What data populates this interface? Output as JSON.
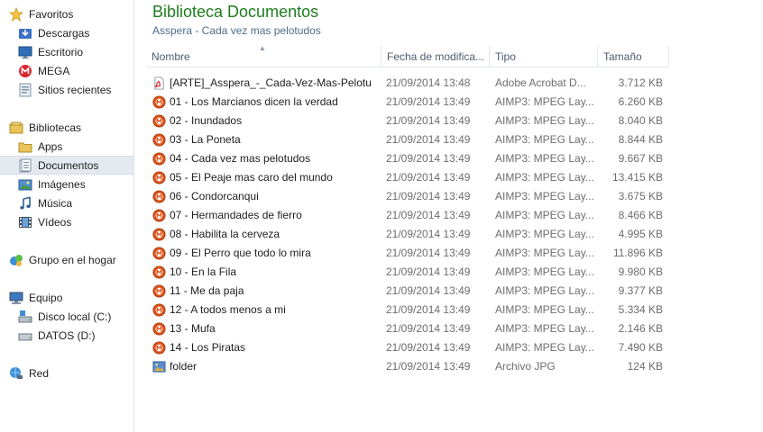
{
  "sidebar": {
    "favorites": {
      "label": "Favoritos",
      "items": [
        {
          "label": "Descargas"
        },
        {
          "label": "Escritorio"
        },
        {
          "label": "MEGA"
        },
        {
          "label": "Sitios recientes"
        }
      ]
    },
    "libraries": {
      "label": "Bibliotecas",
      "items": [
        {
          "label": "Apps"
        },
        {
          "label": "Documentos",
          "selected": true
        },
        {
          "label": "Imágenes"
        },
        {
          "label": "Música"
        },
        {
          "label": "Vídeos"
        }
      ]
    },
    "homegroup": {
      "label": "Grupo en el hogar"
    },
    "computer": {
      "label": "Equipo",
      "items": [
        {
          "label": "Disco local (C:)"
        },
        {
          "label": "DATOS (D:)"
        }
      ]
    },
    "network": {
      "label": "Red"
    }
  },
  "main": {
    "title": "Biblioteca Documentos",
    "subtitle": "Asspera - Cada vez mas pelotudos",
    "columns": {
      "name": "Nombre",
      "date": "Fecha de modifica...",
      "type": "Tipo",
      "size": "Tamaño"
    },
    "files": [
      {
        "name": "[ARTE]_Asspera_-_Cada-Vez-Mas-Pelotu...",
        "date": "21/09/2014 13:48",
        "type": "Adobe Acrobat D...",
        "size": "3.712 KB",
        "icon": "pdf-icon"
      },
      {
        "name": "01 - Los Marcianos dicen la verdad",
        "date": "21/09/2014 13:49",
        "type": "AIMP3: MPEG Lay...",
        "size": "6.260 KB",
        "icon": "aimp-audio-icon"
      },
      {
        "name": "02 - Inundados",
        "date": "21/09/2014 13:49",
        "type": "AIMP3: MPEG Lay...",
        "size": "8.040 KB",
        "icon": "aimp-audio-icon"
      },
      {
        "name": "03 - La Poneta",
        "date": "21/09/2014 13:49",
        "type": "AIMP3: MPEG Lay...",
        "size": "8.844 KB",
        "icon": "aimp-audio-icon"
      },
      {
        "name": "04 - Cada vez mas pelotudos",
        "date": "21/09/2014 13:49",
        "type": "AIMP3: MPEG Lay...",
        "size": "9.667 KB",
        "icon": "aimp-audio-icon"
      },
      {
        "name": "05 - El Peaje mas caro del mundo",
        "date": "21/09/2014 13:49",
        "type": "AIMP3: MPEG Lay...",
        "size": "13.415 KB",
        "icon": "aimp-audio-icon"
      },
      {
        "name": "06 - Condorcanqui",
        "date": "21/09/2014 13:49",
        "type": "AIMP3: MPEG Lay...",
        "size": "3.675 KB",
        "icon": "aimp-audio-icon"
      },
      {
        "name": "07 - Hermandades de fierro",
        "date": "21/09/2014 13:49",
        "type": "AIMP3: MPEG Lay...",
        "size": "8.466 KB",
        "icon": "aimp-audio-icon"
      },
      {
        "name": "08 - Habilita la cerveza",
        "date": "21/09/2014 13:49",
        "type": "AIMP3: MPEG Lay...",
        "size": "4.995 KB",
        "icon": "aimp-audio-icon"
      },
      {
        "name": "09 - El Perro que todo lo mira",
        "date": "21/09/2014 13:49",
        "type": "AIMP3: MPEG Lay...",
        "size": "11.896 KB",
        "icon": "aimp-audio-icon"
      },
      {
        "name": "10 - En la Fila",
        "date": "21/09/2014 13:49",
        "type": "AIMP3: MPEG Lay...",
        "size": "9.980 KB",
        "icon": "aimp-audio-icon"
      },
      {
        "name": "11 - Me da paja",
        "date": "21/09/2014 13:49",
        "type": "AIMP3: MPEG Lay...",
        "size": "9.377 KB",
        "icon": "aimp-audio-icon"
      },
      {
        "name": "12 - A todos menos a mi",
        "date": "21/09/2014 13:49",
        "type": "AIMP3: MPEG Lay...",
        "size": "5.334 KB",
        "icon": "aimp-audio-icon"
      },
      {
        "name": "13 - Mufa",
        "date": "21/09/2014 13:49",
        "type": "AIMP3: MPEG Lay...",
        "size": "2.146 KB",
        "icon": "aimp-audio-icon"
      },
      {
        "name": "14 - Los Piratas",
        "date": "21/09/2014 13:49",
        "type": "AIMP3: MPEG Lay...",
        "size": "7.490 KB",
        "icon": "aimp-audio-icon"
      },
      {
        "name": "folder",
        "date": "21/09/2014 13:49",
        "type": "Archivo JPG",
        "size": "124 KB",
        "icon": "jpg-image-icon"
      }
    ]
  },
  "colors": {
    "title_green": "#1e7d1e",
    "subtitle_blue": "#4a6e8a",
    "selection_bg": "#e5eaf1",
    "aimp_orange": "#e0541a"
  }
}
